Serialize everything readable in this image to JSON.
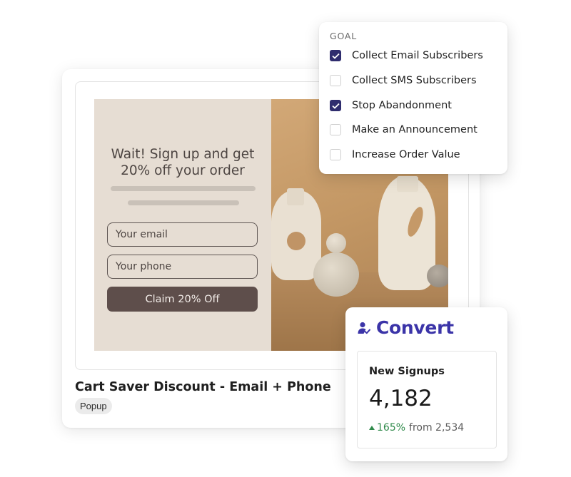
{
  "campaign": {
    "title": "Cart Saver Discount - Email + Phone",
    "type_badge": "Popup"
  },
  "popup": {
    "headline": "Wait! Sign up and get\n20% off your order",
    "email_placeholder": "Your email",
    "phone_placeholder": "Your phone",
    "cta_label": "Claim 20% Off"
  },
  "goal_menu": {
    "heading": "GOAL",
    "options": [
      {
        "label": "Collect Email Subscribers",
        "checked": true
      },
      {
        "label": "Collect SMS Subscribers",
        "checked": false
      },
      {
        "label": "Stop Abandonment",
        "checked": true
      },
      {
        "label": "Make an Announcement",
        "checked": false
      },
      {
        "label": "Increase Order Value",
        "checked": false
      }
    ]
  },
  "convert_card": {
    "brand": "Convert",
    "metric_label": "New Signups",
    "metric_value": "4,182",
    "delta_percent": "165%",
    "delta_from": "from 2,534"
  },
  "colors": {
    "brand": "#3b34a8",
    "checkbox_checked": "#2f2d6e",
    "positive": "#2f8a4a",
    "popup_bg": "#e6ddd3",
    "cta_bg": "#5e4e4b"
  },
  "icons": {
    "brand_icon": "user-plus-icon",
    "check_icon": "check-icon",
    "delta_icon": "triangle-up-icon"
  }
}
